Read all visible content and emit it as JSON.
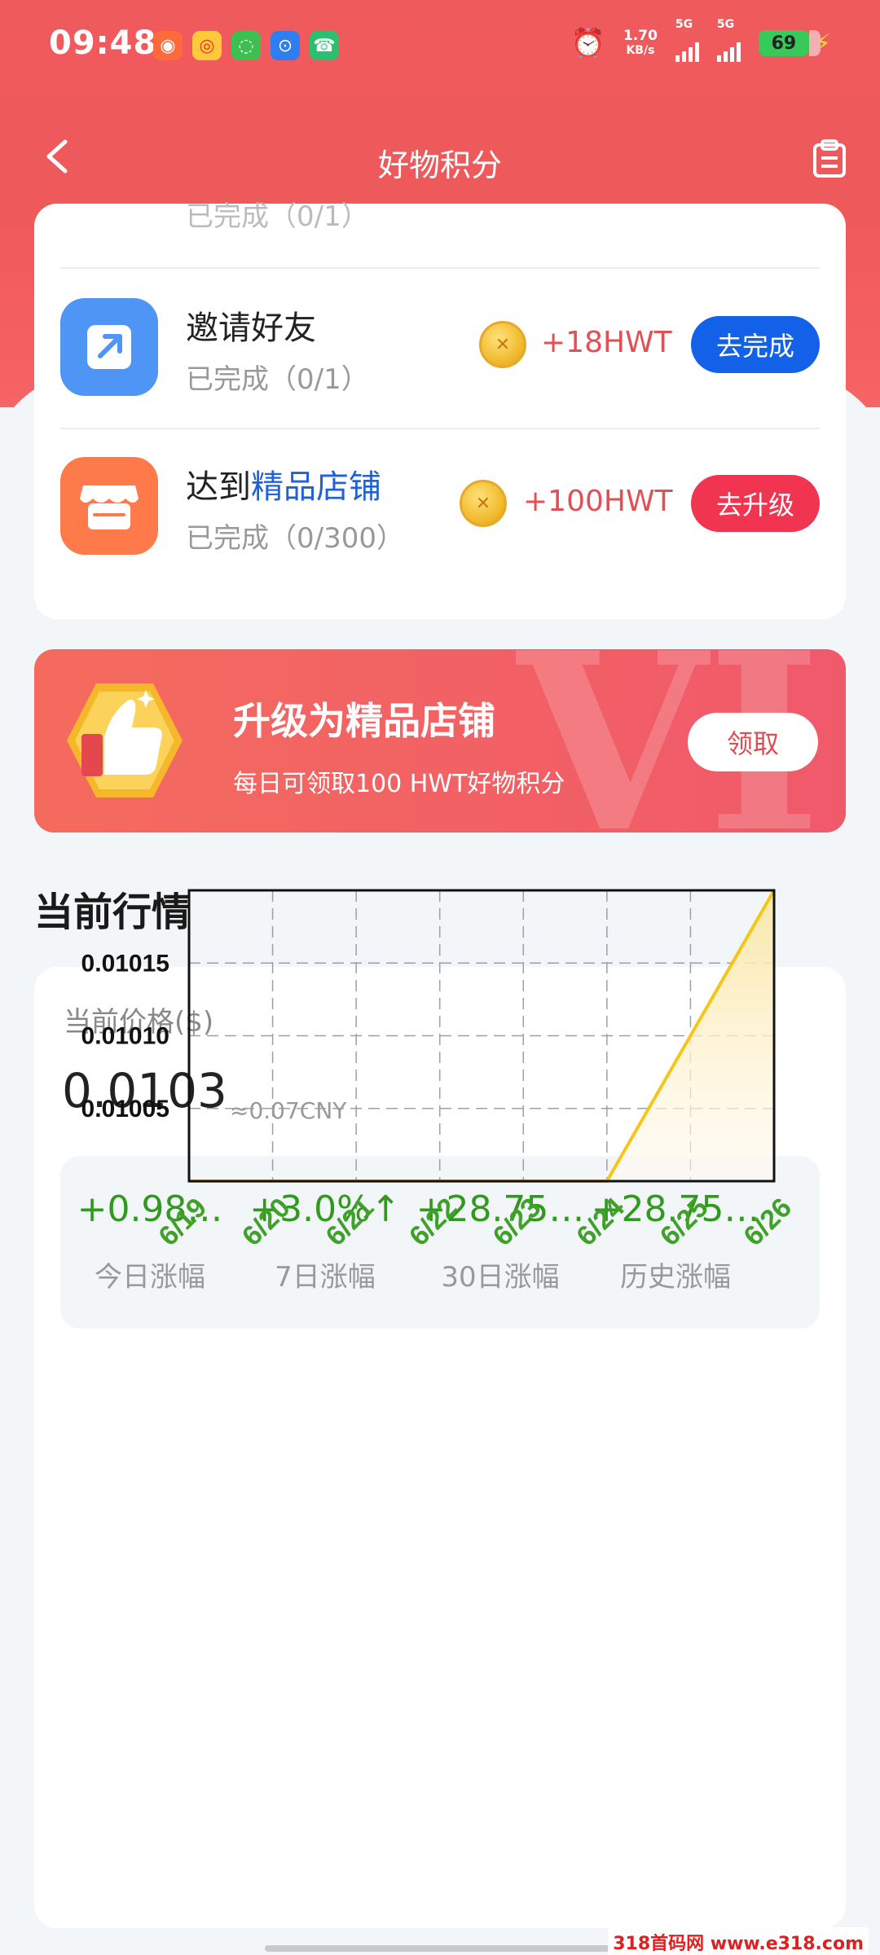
{
  "status_bar": {
    "time": "09:48",
    "net_speed_value": "1.70",
    "net_speed_unit": "KB/s",
    "sim1_label": "5G",
    "sim2_label": "5G",
    "battery": "69"
  },
  "navbar": {
    "title": "好物积分"
  },
  "tasks": {
    "partial_sub": "已完成（0/1）",
    "invite": {
      "title": "邀请好友",
      "sub": "已完成（0/1）",
      "reward": "+18HWT",
      "button": "去完成"
    },
    "shop": {
      "title_prefix": "达到",
      "title_highlight": "精品店铺",
      "sub": "已完成（0/300）",
      "reward": "+100HWT",
      "button": "去升级"
    }
  },
  "promo": {
    "title": "升级为精品店铺",
    "sub": "每日可领取100  HWT好物积分",
    "button": "领取",
    "deco": "VI"
  },
  "market": {
    "section_title": "当前行情",
    "price_label": "当前价格($)",
    "price": "0.0103",
    "price_cny": "≈0.07CNY",
    "stats": [
      {
        "value": "+0.98…",
        "label": "今日涨幅"
      },
      {
        "value": "+3.0%↑",
        "label": "7日涨幅"
      },
      {
        "value": "+28.75…",
        "label": "30日涨幅"
      },
      {
        "value": "+28.75…",
        "label": "历史涨幅"
      }
    ]
  },
  "chart_data": {
    "type": "area",
    "x": [
      "6/19",
      "6/20",
      "6/21",
      "6/22",
      "6/23",
      "6/24",
      "6/25",
      "6/26"
    ],
    "y": [
      0.01,
      0.01,
      0.01,
      0.01,
      0.01,
      0.01,
      0.0101,
      0.0102
    ],
    "y_ticks": [
      "0.01005",
      "0.01010",
      "0.01015"
    ],
    "ylim": [
      0.01,
      0.0102
    ],
    "grid": true,
    "line_color": "#f5c518",
    "fill_color": "#fbe7a6",
    "tick_color_x": "#3fa12a"
  },
  "watermark": "318首码网 www.e318.com"
}
